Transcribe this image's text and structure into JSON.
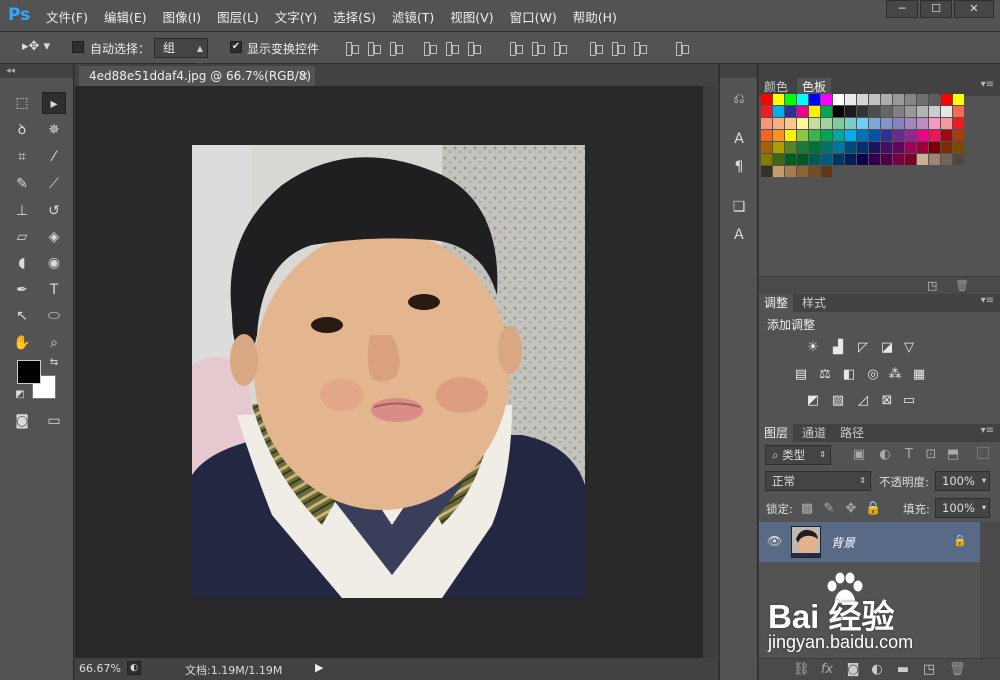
{
  "app": {
    "logo": "Ps",
    "menu": [
      "文件(F)",
      "编辑(E)",
      "图像(I)",
      "图层(L)",
      "文字(Y)",
      "选择(S)",
      "滤镜(T)",
      "视图(V)",
      "窗口(W)",
      "帮助(H)"
    ]
  },
  "window_controls": [
    "─",
    "☐",
    "✕"
  ],
  "options": {
    "auto_select_label": "自动选择：",
    "auto_select_value": "组",
    "show_transform_label": "显示变换控件",
    "show_transform_checked": "✔"
  },
  "document": {
    "tab_title": "4ed88e51ddaf4.jpg @ 66.7%(RGB/8)",
    "close": "×",
    "zoom": "66.67%",
    "doc_size": "文档:1.19M/1.19M"
  },
  "panels": {
    "color_tabs": [
      "颜色",
      "色板"
    ],
    "adjust_tabs": [
      "调整",
      "样式"
    ],
    "adjust_title": "添加调整",
    "layers_tabs": [
      "图层",
      "通道",
      "路径"
    ],
    "filter_kind": "类型",
    "blend_mode": "正常",
    "opacity_label": "不透明度:",
    "opacity_value": "100%",
    "lock_label": "锁定:",
    "fill_label": "填充:",
    "fill_value": "100%",
    "layer_name": "背景"
  },
  "watermark": {
    "text": "Bai  经验",
    "url": "jingyan.baidu.com"
  },
  "colors": {
    "accent": "#31a8ff",
    "selected_layer": "#586a86"
  }
}
